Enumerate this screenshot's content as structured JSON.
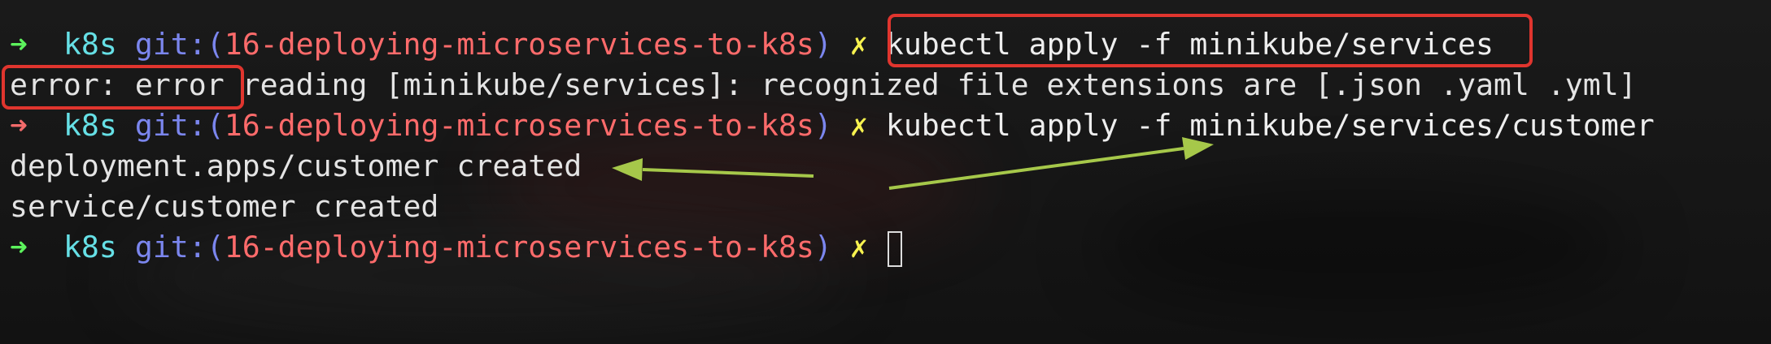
{
  "prompt": {
    "arrow": "➜",
    "directory": "k8s",
    "git_label": "git:(",
    "branch": "16-deploying-microservices-to-k8s",
    "git_close": ")",
    "dirty_mark": "✗"
  },
  "lines": [
    {
      "type": "prompt",
      "command": "kubectl apply -f minikube/services"
    },
    {
      "type": "output",
      "text": "error: error reading [minikube/services]: recognized file extensions are [.json .yaml .yml]"
    },
    {
      "type": "prompt",
      "command": "kubectl apply -f minikube/services/customer"
    },
    {
      "type": "output",
      "text": "deployment.apps/customer created"
    },
    {
      "type": "output",
      "text": "service/customer created"
    },
    {
      "type": "prompt",
      "command": ""
    }
  ],
  "colors": {
    "prompt_arrow_success": "#5cf25c",
    "prompt_arrow_error": "#f26a6a",
    "directory": "#66e0e6",
    "git_label": "#7b86ee",
    "branch": "#ff6b6b",
    "dirty_mark": "#f7f24f",
    "highlight_box": "#e0352e",
    "annotation_arrow": "#a6c84a"
  }
}
